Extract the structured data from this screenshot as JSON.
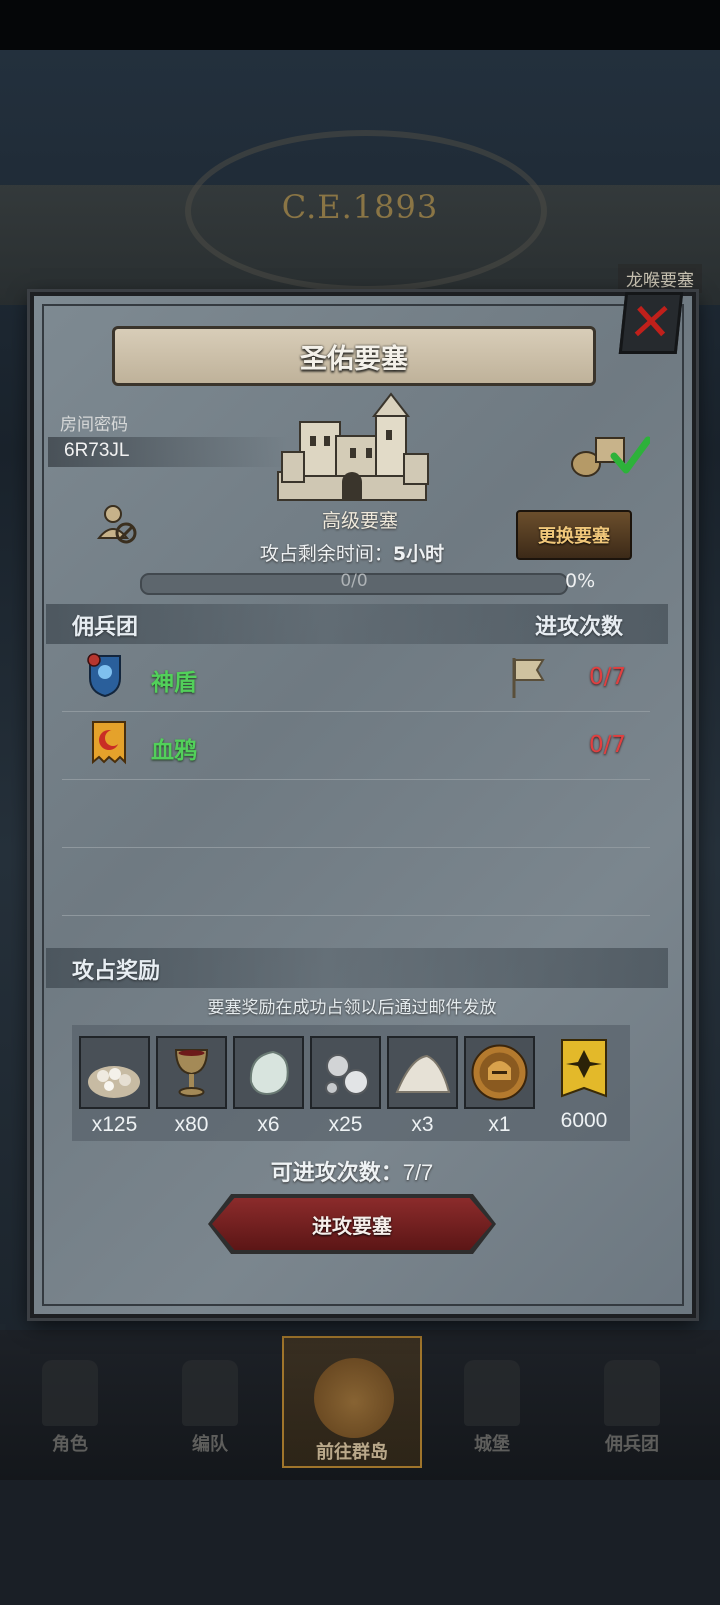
{
  "background": {
    "year": "C.E.1893",
    "place_label": "龙喉要塞"
  },
  "dialog": {
    "title": "圣佑要塞",
    "room_code_label": "房间密码",
    "room_code": "6R73JL",
    "fortress_type": "高级要塞",
    "change_button": "更换要塞",
    "time_label": "攻占剩余时间：",
    "time_value": "5小时",
    "progress_text": "0/0",
    "progress_fraction": 0,
    "progress_percent": "0%",
    "guild_section_title": "佣兵团",
    "attack_count_header": "进攻次数",
    "guilds": [
      {
        "name": "神盾",
        "count": "0/7",
        "color": "#52d05a"
      },
      {
        "name": "血鸦",
        "count": "0/7",
        "color": "#52d05a"
      }
    ],
    "reward_section_title": "攻占奖励",
    "reward_note": "要塞奖励在成功占领以后通过邮件发放",
    "rewards": [
      {
        "icon": "gem-pile-icon",
        "qty": "x125"
      },
      {
        "icon": "goblet-icon",
        "qty": "x80"
      },
      {
        "icon": "moonstone-icon",
        "qty": "x6"
      },
      {
        "icon": "silver-orbs-icon",
        "qty": "x25"
      },
      {
        "icon": "salt-pile-icon",
        "qty": "x3"
      },
      {
        "icon": "helmet-medal-icon",
        "qty": "x1"
      },
      {
        "icon": "honor-banner-icon",
        "qty": "6000"
      }
    ],
    "attacks_left_label": "可进攻次数：",
    "attacks_left_value": "7/7",
    "attack_button": "进攻要塞"
  },
  "nav": {
    "items": [
      {
        "label": "角色"
      },
      {
        "label": "编队"
      },
      {
        "label": "前往群岛"
      },
      {
        "label": "城堡"
      },
      {
        "label": "佣兵团"
      }
    ]
  },
  "colors": {
    "accent_red": "#e04040",
    "guild_green": "#52d05a",
    "button_gold_text": "#f0c77a"
  }
}
